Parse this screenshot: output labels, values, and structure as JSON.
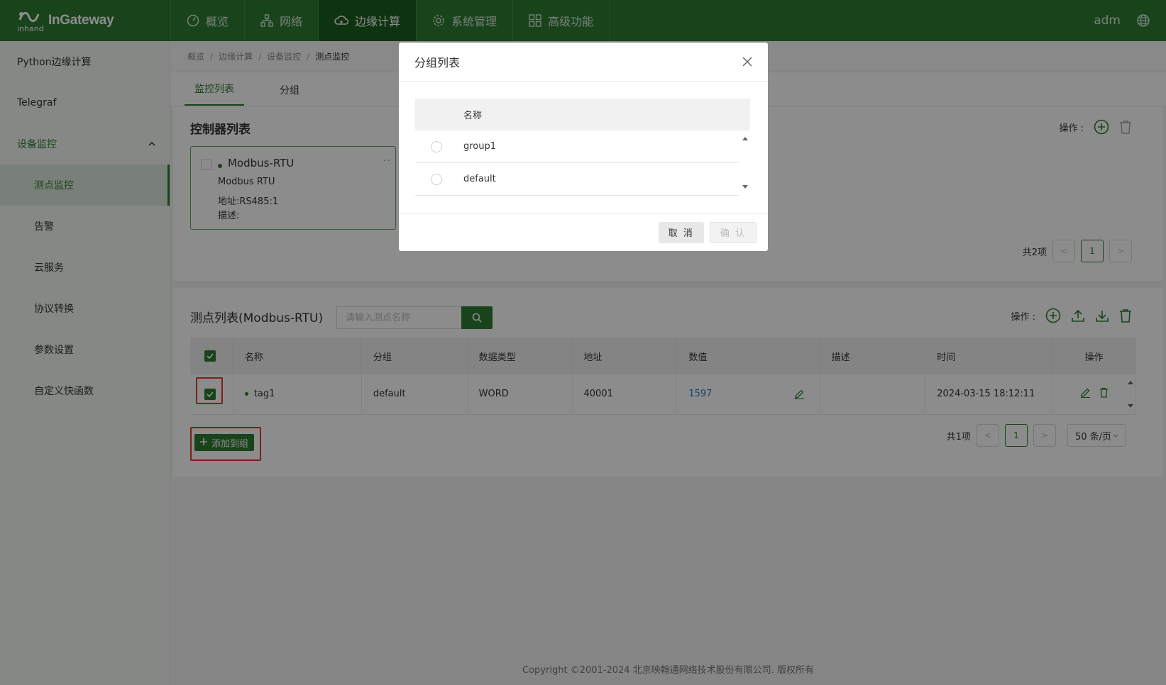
{
  "brand": {
    "logo_text": "inhand",
    "name": "InGateway"
  },
  "topnav": [
    {
      "label": "概览",
      "icon": "dashboard-icon"
    },
    {
      "label": "网络",
      "icon": "network-icon"
    },
    {
      "label": "边缘计算",
      "icon": "cloud-icon",
      "active": true
    },
    {
      "label": "系统管理",
      "icon": "gear-icon"
    },
    {
      "label": "高级功能",
      "icon": "grid-icon"
    }
  ],
  "user": "adm",
  "sidebar": {
    "items": [
      {
        "label": "Python边缘计算"
      },
      {
        "label": "Telegraf"
      },
      {
        "label": "设备监控",
        "expanded": true
      },
      {
        "label": "测点监控",
        "active": true
      },
      {
        "label": "告警"
      },
      {
        "label": "云服务"
      },
      {
        "label": "协议转换"
      },
      {
        "label": "参数设置"
      },
      {
        "label": "自定义快函数"
      }
    ]
  },
  "breadcrumb": [
    "概览",
    "边缘计算",
    "设备监控",
    "测点监控"
  ],
  "tabs": [
    {
      "label": "监控列表",
      "active": true
    },
    {
      "label": "分组"
    }
  ],
  "controllers": {
    "title": "控制器列表",
    "ops_label": "操作 :",
    "card": {
      "name": "Modbus-RTU",
      "protocol": "Modbus RTU",
      "address": "地址:RS485:1",
      "desc": "描述:",
      "more": "··"
    },
    "pager": {
      "total": "共2项",
      "page": "1"
    }
  },
  "points": {
    "title": "测点列表(Modbus-RTU)",
    "search_placeholder": "请输入测点名称",
    "ops_label": "操作 :",
    "columns": [
      "名称",
      "分组",
      "数据类型",
      "地址",
      "数值",
      "描述",
      "时间",
      "操作"
    ],
    "rows": [
      {
        "name": "tag1",
        "group": "default",
        "type": "WORD",
        "address": "40001",
        "value": "1597",
        "desc": "",
        "time": "2024-03-15 18:12:11"
      }
    ],
    "add_button": "添加到组",
    "pager": {
      "total": "共1项",
      "page": "1",
      "size": "50 条/页"
    }
  },
  "footer": "Copyright ©2001-2024 北京映翰通网络技术股份有限公司. 版权所有",
  "modal": {
    "title": "分组列表",
    "column": "名称",
    "groups": [
      "group1",
      "default"
    ],
    "cancel": "取 消",
    "confirm": "确 认"
  },
  "colors": {
    "brand": "#2e7d32",
    "accent_dark": "#1b5e20",
    "highlight": "#e53935",
    "link": "#1e7fc1"
  }
}
